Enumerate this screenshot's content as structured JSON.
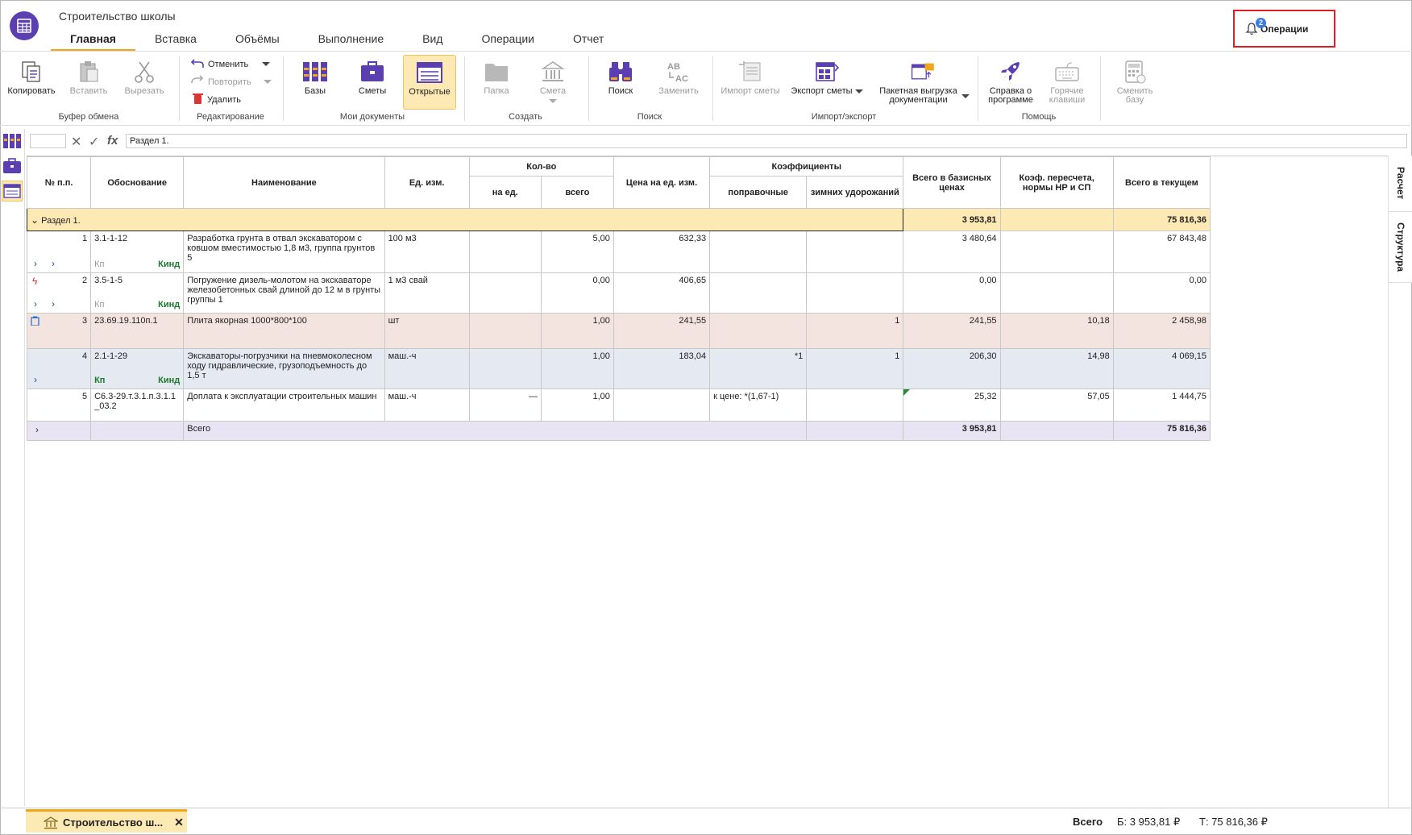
{
  "app": {
    "title": "Строительство школы"
  },
  "tabs": [
    {
      "label": "Главная",
      "active": true
    },
    {
      "label": "Вставка"
    },
    {
      "label": "Объёмы"
    },
    {
      "label": "Выполнение"
    },
    {
      "label": "Вид"
    },
    {
      "label": "Операции"
    },
    {
      "label": "Отчет"
    }
  ],
  "operations": {
    "label": "Операции",
    "badge": "2"
  },
  "ribbon": {
    "clipboard": {
      "copy": "Копировать",
      "paste": "Вставить",
      "cut": "Вырезать",
      "group": "Буфер обмена"
    },
    "edit": {
      "undo": "Отменить",
      "redo": "Повторить",
      "delete": "Удалить",
      "group": "Редактирование"
    },
    "docs": {
      "bases": "Базы",
      "estimates": "Сметы",
      "open": "Открытые",
      "group": "Мои документы"
    },
    "create": {
      "folder": "Папка",
      "estimate": "Смета",
      "group": "Создать"
    },
    "search": {
      "find": "Поиск",
      "replace": "Заменить",
      "group": "Поиск"
    },
    "io": {
      "import": "Импорт сметы",
      "export": "Экспорт сметы",
      "batch": "Пакетная выгрузка документации",
      "group": "Импорт/экспорт"
    },
    "help": {
      "about": "Справка о программе",
      "hotkeys": "Горячие клавиши",
      "group": "Помощь"
    },
    "switch_base": "Сменить базу"
  },
  "formula": {
    "value": "Раздел 1.",
    "fx": "fx"
  },
  "side_tabs": {
    "calc": "Расчет",
    "structure": "Структура"
  },
  "table": {
    "headers": {
      "num": "№ п.п.",
      "basis": "Обоснование",
      "name": "Наименование",
      "unit": "Ед. изм.",
      "qty": "Кол-во",
      "qty_unit": "на ед.",
      "qty_total": "всего",
      "price": "Цена на ед. изм.",
      "coef": "Коэффициенты",
      "coef_corr": "поправочные",
      "coef_winter": "зимних удорожаний",
      "total_base": "Всего в базисных ценах",
      "recalc": "Коэф. пересчета, нормы НР и СП",
      "total_current": "Всего в текущем"
    },
    "section": {
      "label": "Раздел 1.",
      "total_base": "3 953,81",
      "total_current": "75 816,36"
    },
    "rows": [
      {
        "num": "1",
        "basis": "3.1-1-12",
        "name": "Разработка грунта в отвал экскаватором с ковшом вместимостью 1,8 м3, группа грунтов 5",
        "unit": "100 м3",
        "qty_unit": "",
        "qty_total": "5,00",
        "price": "632,33",
        "coef_corr": "",
        "coef_winter": "",
        "total_base": "3 480,64",
        "recalc": "",
        "total_current": "67 843,48",
        "kp": "Кп",
        "kind": "Кинд"
      },
      {
        "num": "2",
        "basis": "3.5-1-5",
        "name": "Погружение дизель-молотом на экскаваторе железобетонных свай длиной до 12 м в грунты группы 1",
        "unit": "1 м3 свай",
        "qty_unit": "",
        "qty_total": "0,00",
        "price": "406,65",
        "coef_corr": "",
        "coef_winter": "",
        "total_base": "0,00",
        "recalc": "",
        "total_current": "0,00",
        "kp": "Кп",
        "kind": "Кинд"
      },
      {
        "num": "3",
        "basis": "23.69.19.110п.1",
        "name": "Плита якорная 1000*800*100",
        "unit": "шт",
        "qty_unit": "",
        "qty_total": "1,00",
        "price": "241,55",
        "coef_corr": "",
        "coef_winter": "1",
        "total_base": "241,55",
        "recalc": "10,18",
        "total_current": "2 458,98"
      },
      {
        "num": "4",
        "basis": "2.1-1-29",
        "name": "Экскаваторы-погрузчики на пневмоколесном ходу гидравлические, грузоподъемность до 1,5 т",
        "unit": "маш.-ч",
        "qty_unit": "",
        "qty_total": "1,00",
        "price": "183,04",
        "coef_corr": "*1",
        "coef_winter": "1",
        "total_base": "206,30",
        "recalc": "14,98",
        "total_current": "4 069,15",
        "kp": "Кп",
        "kind": "Кинд"
      },
      {
        "num": "5",
        "basis": "С6.3-29.т.3.1.п.3.1.1_03.2",
        "name": "Доплата к эксплуатации строительных машин",
        "unit": "маш.-ч",
        "qty_unit": "—",
        "qty_total": "1,00",
        "price": "",
        "coef_corr": "к цене: *(1,67-1)",
        "coef_winter": "",
        "total_base": "25,32",
        "recalc": "57,05",
        "total_current": "1 444,75"
      }
    ],
    "total": {
      "label": "Всего",
      "total_base": "3 953,81",
      "total_current": "75 816,36"
    }
  },
  "status": {
    "doc_tab": "Строительство ш...",
    "total_label": "Всего",
    "base": "Б: 3 953,81 ₽",
    "current": "Т: 75 816,36 ₽"
  },
  "colors": {
    "accent": "#f2a71b",
    "brand": "#5b3fb0",
    "highlight": "#e02020"
  }
}
